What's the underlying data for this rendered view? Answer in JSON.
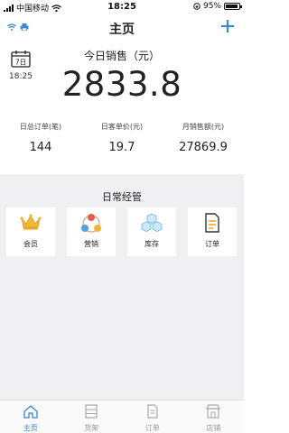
{
  "status_bar": {
    "carrier": "中国移动",
    "time": "18:25",
    "battery": "95%",
    "battery_level": 0.95
  },
  "header": {
    "title": "主页",
    "add_icon": "plus-icon"
  },
  "summary": {
    "calendar_day": "7日",
    "time": "18:25",
    "sales_title": "今日销售（元）",
    "sales_value": "2833.8",
    "stats": [
      {
        "label": "日总订单(笔)",
        "value": "144"
      },
      {
        "label": "日客单价(元)",
        "value": "19.7"
      },
      {
        "label": "月销售额(元)",
        "value": "27869.9"
      }
    ]
  },
  "daily": {
    "title": "日常经管",
    "tiles": [
      {
        "label": "会员",
        "icon": "crown-icon"
      },
      {
        "label": "营销",
        "icon": "marketing-icon"
      },
      {
        "label": "库存",
        "icon": "inventory-icon"
      },
      {
        "label": "订单",
        "icon": "order-icon"
      }
    ]
  },
  "tabbar": {
    "tabs": [
      {
        "label": "主页",
        "icon": "home-icon"
      },
      {
        "label": "货架",
        "icon": "shelf-icon"
      },
      {
        "label": "订单",
        "icon": "order-icon"
      },
      {
        "label": "店铺",
        "icon": "store-icon"
      }
    ],
    "active_color": "#3b86d6",
    "inactive_color": "#999999"
  },
  "colors": {
    "accent": "#3b86d6",
    "background_grey": "#f0f0f2"
  }
}
